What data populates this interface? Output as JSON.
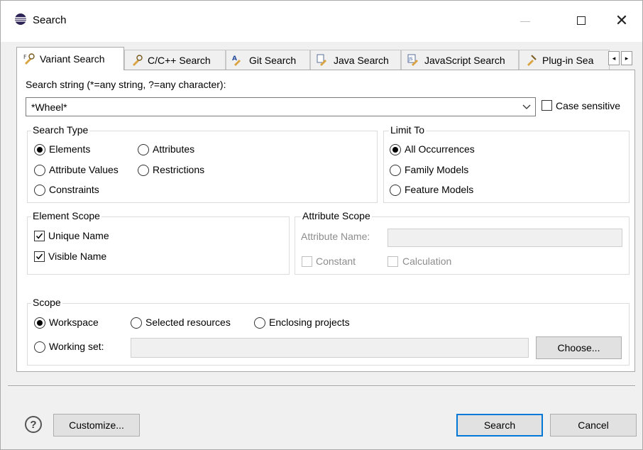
{
  "window": {
    "title": "Search",
    "minimize": "—",
    "maximize": "☐",
    "close": "✕"
  },
  "tabs": [
    {
      "label": "Variant Search",
      "active": true,
      "icon": "variant-search-icon"
    },
    {
      "label": "C/C++ Search",
      "active": false,
      "icon": "cpp-search-icon"
    },
    {
      "label": "Git Search",
      "active": false,
      "icon": "git-search-icon"
    },
    {
      "label": "Java Search",
      "active": false,
      "icon": "java-search-icon"
    },
    {
      "label": "JavaScript Search",
      "active": false,
      "icon": "javascript-search-icon"
    },
    {
      "label": "Plug-in Sea",
      "active": false,
      "icon": "plugin-search-icon"
    }
  ],
  "tab_scroll": {
    "left": "◂",
    "right": "▸"
  },
  "search_string": {
    "label": "Search string (*=any string, ?=any character):",
    "value": "*Wheel*",
    "case_sensitive_label": "Case sensitive",
    "case_sensitive": false
  },
  "search_type": {
    "title": "Search Type",
    "options": [
      "Elements",
      "Attributes",
      "Attribute Values",
      "Restrictions",
      "Constraints"
    ],
    "selected": "Elements"
  },
  "limit_to": {
    "title": "Limit To",
    "options": [
      "All Occurrences",
      "Family Models",
      "Feature Models"
    ],
    "selected": "All Occurrences"
  },
  "element_scope": {
    "title": "Element Scope",
    "unique_name": "Unique Name",
    "visible_name": "Visible Name",
    "unique_checked": true,
    "visible_checked": true
  },
  "attribute_scope": {
    "title": "Attribute Scope",
    "attribute_name_label": "Attribute Name:",
    "attribute_name_value": "",
    "constant": "Constant",
    "calculation": "Calculation"
  },
  "scope": {
    "title": "Scope",
    "workspace": "Workspace",
    "selected_resources": "Selected resources",
    "enclosing_projects": "Enclosing projects",
    "working_set": "Working set:",
    "working_set_value": "",
    "choose": "Choose...",
    "selected": "Workspace"
  },
  "footer": {
    "help": "?",
    "customize": "Customize...",
    "search": "Search",
    "cancel": "Cancel"
  },
  "colors": {
    "accent": "#0078d7",
    "background": "#f0f0f0",
    "panel": "#ffffff"
  }
}
